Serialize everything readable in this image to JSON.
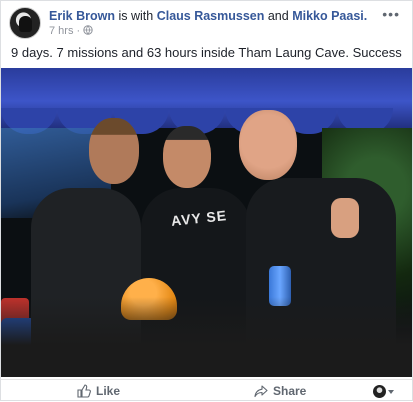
{
  "post": {
    "author": "Erik Brown",
    "with_text": " is with ",
    "tag_1": "Claus Rasmussen",
    "and_text": " and ",
    "tag_2": "Mikko Paasi.",
    "time": "7 hrs · ",
    "privacy_icon": "globe-icon",
    "options_icon": "more-options-icon",
    "text": "9 days. 7 missions and 63 hours inside Tham Laung Cave. Success",
    "photo_caption_visible": "AVY SE"
  },
  "actions": {
    "like_label": "Like",
    "like_icon": "thumbs-up-icon",
    "share_label": "Share",
    "share_icon": "share-arrow-icon",
    "reaction_selector_icon": "profile-selector-icon"
  },
  "colors": {
    "link": "#365899",
    "text": "#1d2129",
    "meta": "#90949c",
    "tent_blue": "#3d55c8",
    "helmet_orange": "#e58a16"
  }
}
